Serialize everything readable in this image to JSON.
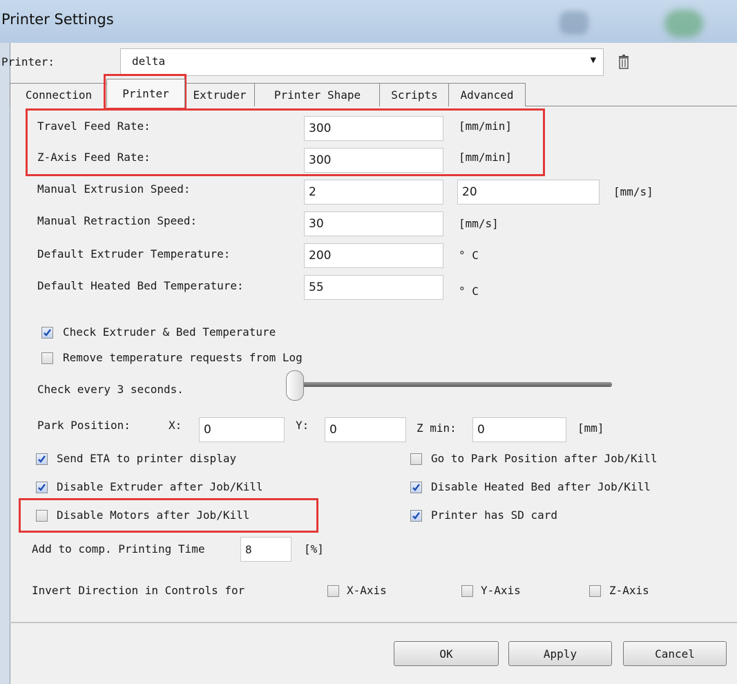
{
  "window": {
    "title": "Printer Settings"
  },
  "printer": {
    "label": "Printer:",
    "value": "delta"
  },
  "tabs": [
    "Connection",
    "Printer",
    "Extruder",
    "Printer Shape",
    "Scripts",
    "Advanced"
  ],
  "active_tab": "Printer",
  "fields": {
    "travel_feed": {
      "label": "Travel Feed Rate:",
      "value": "300",
      "unit": "[mm/min]"
    },
    "z_feed": {
      "label": "Z-Axis Feed Rate:",
      "value": "300",
      "unit": "[mm/min]"
    },
    "manual_extrusion": {
      "label": "Manual Extrusion Speed:",
      "value1": "2",
      "value2": "20",
      "unit": "[mm/s]"
    },
    "manual_retraction": {
      "label": "Manual Retraction Speed:",
      "value": "30",
      "unit": "[mm/s]"
    },
    "extruder_temp": {
      "label": "Default Extruder Temperature:",
      "value": "200",
      "unit": "° C"
    },
    "bed_temp": {
      "label": "Default Heated Bed Temperature:",
      "value": "55",
      "unit": "° C"
    }
  },
  "checks": {
    "check_temp": {
      "label": "Check Extruder & Bed Temperature",
      "checked": true
    },
    "remove_temp": {
      "label": "Remove temperature requests from Log",
      "checked": false
    },
    "send_eta": {
      "label": "Send ETA to printer display",
      "checked": true
    },
    "go_park": {
      "label": "Go to Park Position after Job/Kill",
      "checked": false
    },
    "disable_extruder": {
      "label": "Disable Extruder after Job/Kill",
      "checked": true
    },
    "disable_bed": {
      "label": "Disable Heated Bed after Job/Kill",
      "checked": true
    },
    "disable_motors": {
      "label": "Disable Motors after Job/Kill",
      "checked": false
    },
    "has_sd": {
      "label": "Printer has SD card",
      "checked": true
    },
    "x_axis": {
      "label": "X-Axis",
      "checked": false
    },
    "y_axis": {
      "label": "Y-Axis",
      "checked": false
    },
    "z_axis": {
      "label": "Z-Axis",
      "checked": false
    }
  },
  "check_every": {
    "label": "Check every 3 seconds.",
    "slider_fraction": 0.0
  },
  "park": {
    "label": "Park Position:",
    "x_label": "X:",
    "x_value": "0",
    "y_label": "Y:",
    "y_value": "0",
    "z_label": "Z min:",
    "z_value": "0",
    "unit": "[mm]"
  },
  "comp_time": {
    "label": "Add to comp. Printing Time",
    "value": "8",
    "unit": "[%]"
  },
  "invert": {
    "label": "Invert Direction in Controls for"
  },
  "buttons": {
    "ok": "OK",
    "apply": "Apply",
    "cancel": "Cancel"
  },
  "colors": {
    "highlight": "#e33838",
    "titlebar": "#b5cbe3",
    "checkmark": "#1f4fb3"
  }
}
